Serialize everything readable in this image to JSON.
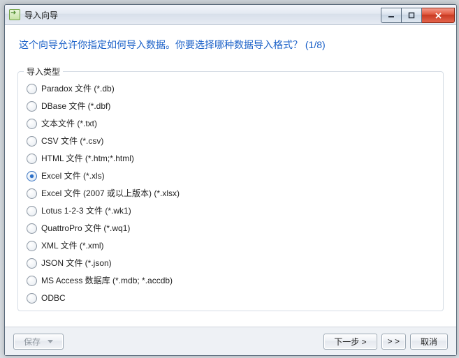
{
  "window": {
    "title": "导入向导"
  },
  "prompt": "这个向导允许你指定如何导入数据。你要选择哪种数据导入格式？ (1/8)",
  "group": {
    "legend": "导入类型",
    "options": [
      "Paradox 文件 (*.db)",
      "DBase 文件 (*.dbf)",
      "文本文件 (*.txt)",
      "CSV 文件 (*.csv)",
      "HTML 文件 (*.htm;*.html)",
      "Excel 文件 (*.xls)",
      "Excel 文件 (2007 或以上版本) (*.xlsx)",
      "Lotus 1-2-3 文件 (*.wk1)",
      "QuattroPro 文件 (*.wq1)",
      "XML 文件 (*.xml)",
      "JSON 文件 (*.json)",
      "MS Access 数据库 (*.mdb; *.accdb)",
      "ODBC"
    ],
    "selected_index": 5
  },
  "footer": {
    "save": "保存",
    "next": "下一步 >",
    "skip": "> >",
    "cancel": "取消"
  }
}
